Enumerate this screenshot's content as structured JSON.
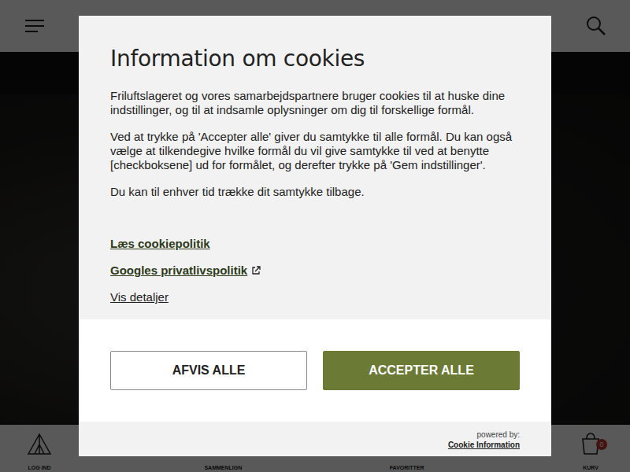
{
  "header": {
    "menu_label": "Menu",
    "search_label": "Søg"
  },
  "dialog": {
    "title": "Information om cookies",
    "paragraphs": [
      "Friluftslageret og vores samarbejdspartnere bruger cookies til at huske dine indstillinger, og til at indsamle oplysninger om dig til forskellige formål.",
      "Ved at trykke på 'Accepter alle' giver du samtykke til alle formål. Du kan også vælge at tilkendegive hvilke formål du vil give samtykke til ved at benytte [checkboksene] ud for formålet, og derefter trykke på 'Gem indstillinger'.",
      "Du kan til enhver tid trække dit samtykke tilbage."
    ],
    "links": [
      {
        "label": "Læs cookiepolitik",
        "external": false,
        "strong": true
      },
      {
        "label": "Googles privatlivspolitik",
        "external": true,
        "strong": true
      },
      {
        "label": "Vis detaljer",
        "external": false,
        "strong": false
      }
    ],
    "buttons": [
      {
        "label": "AFVIS ALLE",
        "primary": false
      },
      {
        "label": "ACCEPTER ALLE",
        "primary": true
      }
    ],
    "powered_by": "powered by:",
    "provider": "Cookie Information"
  },
  "bottom_nav": [
    {
      "label": "LOG IND",
      "icon": "tent",
      "badge": ""
    },
    {
      "label": "SAMMENLIGN",
      "icon": "compare",
      "badge": ""
    },
    {
      "label": "FAVORITTER",
      "icon": "heart",
      "badge": ""
    },
    {
      "label": "KURV",
      "icon": "basket",
      "badge": "0"
    }
  ]
}
